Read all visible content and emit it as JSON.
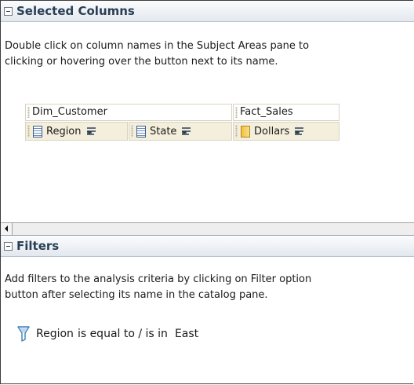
{
  "selected_columns": {
    "title": "Selected Columns",
    "help_line1": "Double click on column names in the Subject Areas pane to",
    "help_line2": "clicking or hovering over the button next to its name.",
    "groups": [
      {
        "label": "Dim_Customer",
        "columns": [
          "Region",
          "State"
        ]
      },
      {
        "label": "Fact_Sales",
        "columns": [
          "Dollars"
        ]
      }
    ]
  },
  "filters": {
    "title": "Filters",
    "help_line1": "Add filters to the analysis criteria by clicking on Filter option",
    "help_line2": "button after selecting its name in the catalog pane.",
    "items": [
      {
        "column": "Region",
        "operator": "is equal to / is in",
        "value": "East"
      }
    ]
  },
  "colors": {
    "header_title": "#2a3f55",
    "chip_bg": "#f4efdc",
    "measure_icon": "#f7c13a",
    "funnel_icon": "#3f7fb8"
  },
  "icons": {
    "collapse": "minus-box-icon",
    "attribute": "attribute-column-icon",
    "measure": "measure-column-icon",
    "menu": "column-options-menu-icon",
    "filter": "funnel-icon"
  }
}
